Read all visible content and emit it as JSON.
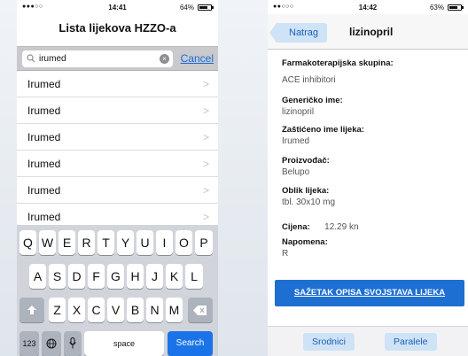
{
  "left": {
    "status": {
      "signal": "●●●○○",
      "time": "14:41",
      "battery_text": "64%",
      "battery_level": 0.64
    },
    "title": "Lista lijekova HZZO-a",
    "search": {
      "query": "irumed",
      "cancel": "Cancel"
    },
    "results": [
      "Irumed",
      "Irumed",
      "Irumed",
      "Irumed",
      "Irumed",
      "Irumed"
    ],
    "keyboard": {
      "row1": [
        "Q",
        "W",
        "E",
        "R",
        "T",
        "Y",
        "U",
        "I",
        "O",
        "P"
      ],
      "row2": [
        "A",
        "S",
        "D",
        "F",
        "G",
        "H",
        "J",
        "K",
        "L"
      ],
      "row3": [
        "Z",
        "X",
        "C",
        "V",
        "B",
        "N",
        "M"
      ],
      "key_123": "123",
      "space": "space",
      "search": "Search"
    }
  },
  "right": {
    "status": {
      "signal": "●●○○○",
      "time": "14:42",
      "battery_text": "63%",
      "battery_level": 0.63
    },
    "back": "Natrag",
    "title": "lizinopril",
    "fields": {
      "farm_label": "Farmakoterapijska skupina:",
      "farm_value": "ACE inhibitori",
      "gen_label": "Generičko ime:",
      "gen_value": "lizinopril",
      "zast_label": "Zaštićeno ime lijeka:",
      "zast_value": "Irumed",
      "proiz_label": "Proizvođač:",
      "proiz_value": "Belupo",
      "oblik_label": "Oblik lijeka:",
      "oblik_value": "tbl. 30x10 mg",
      "cijena_label": "Cijena:",
      "cijena_value": "12.29 kn",
      "napomena_label": "Napomena:",
      "napomena_value": "R"
    },
    "cta": "SAŽETAK OPISA SVOJSTAVA LIJEKA",
    "tabs": {
      "srodnici": "Srodnici",
      "paralele": "Paralele"
    }
  }
}
